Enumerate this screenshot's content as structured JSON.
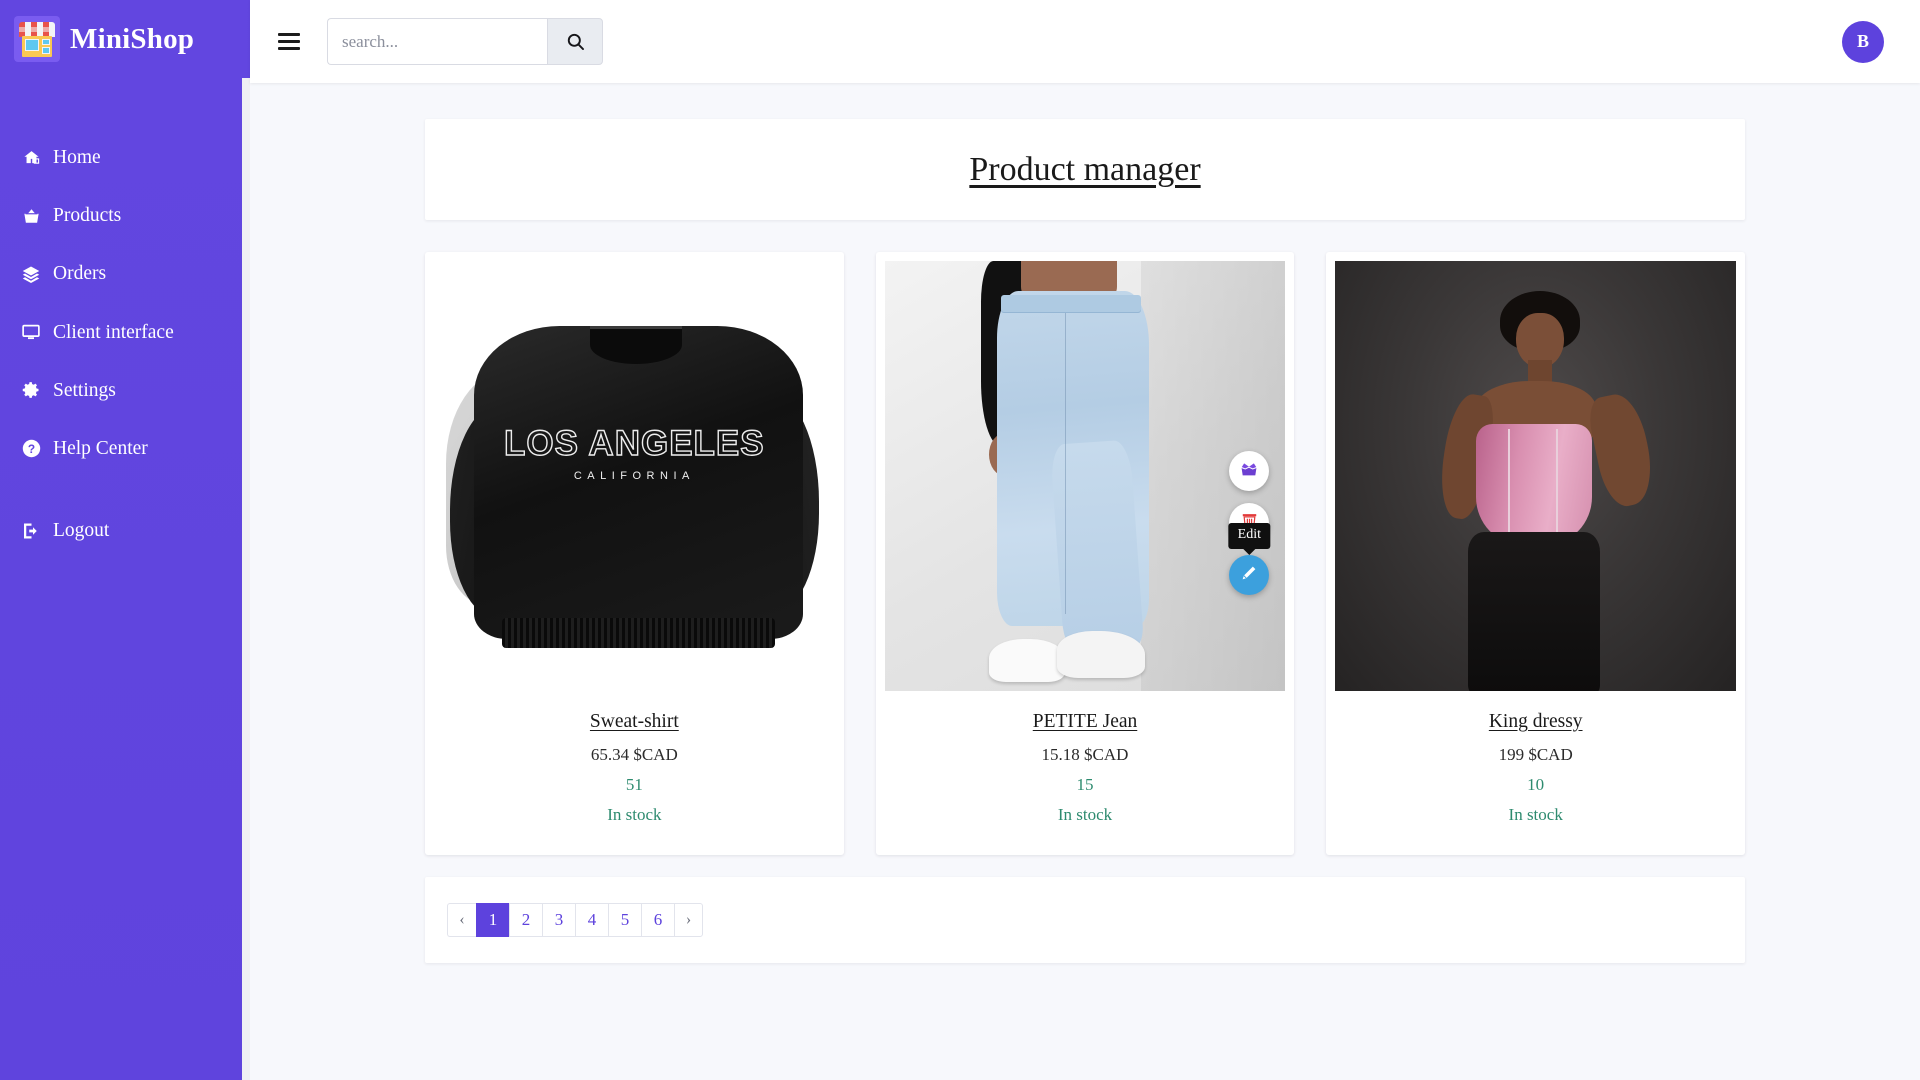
{
  "brand": {
    "name": "MiniShop",
    "logo_icon": "storefront-icon"
  },
  "sidebar": {
    "items": [
      {
        "label": "Home",
        "icon": "home-icon"
      },
      {
        "label": "Products",
        "icon": "basket-icon"
      },
      {
        "label": "Orders",
        "icon": "layers-icon"
      },
      {
        "label": "Client interface",
        "icon": "desktop-icon"
      },
      {
        "label": "Settings",
        "icon": "gear-icon"
      },
      {
        "label": "Help Center",
        "icon": "question-circle-icon"
      }
    ],
    "logout": {
      "label": "Logout",
      "icon": "sign-out-icon"
    }
  },
  "topbar": {
    "menu_icon": "hamburger-icon",
    "search": {
      "value": "",
      "placeholder": "search...",
      "button_icon": "search-icon"
    },
    "avatar": {
      "initial": "B"
    }
  },
  "page": {
    "title": "Product manager"
  },
  "products": [
    {
      "name": "Sweat-shirt",
      "price": "65.34 $CAD",
      "quantity": "51",
      "status": "In stock",
      "image_alt": "black Los Angeles California sweatshirt",
      "image_text_line1": "LOS ANGELES",
      "image_text_line2": "CALIFORNIA"
    },
    {
      "name": "PETITE Jean",
      "price": "15.18 $CAD",
      "quantity": "15",
      "status": "In stock",
      "image_alt": "model wearing light blue petite mom jeans with white sneakers",
      "actions": [
        {
          "name": "archive-button",
          "icon": "open-box-icon",
          "active": false,
          "tooltip": ""
        },
        {
          "name": "delete-button",
          "icon": "trash-icon",
          "active": false,
          "tooltip": ""
        },
        {
          "name": "edit-button",
          "icon": "pencil-icon",
          "active": true,
          "tooltip": "Edit"
        }
      ]
    },
    {
      "name": "King dressy",
      "price": "199 $CAD",
      "quantity": "10",
      "status": "In stock",
      "image_alt": "model wearing pink corset top and black trousers"
    }
  ],
  "pagination": {
    "prev": "‹",
    "next": "›",
    "pages": [
      "1",
      "2",
      "3",
      "4",
      "5",
      "6"
    ],
    "current": "1"
  },
  "colors": {
    "brand_purple": "#5d42dd",
    "sidebar_gradient_start": "#6246e0",
    "status_green": "#2e8b6f",
    "edit_blue": "#3ca0dd",
    "page_bg": "#f7f8fc"
  }
}
